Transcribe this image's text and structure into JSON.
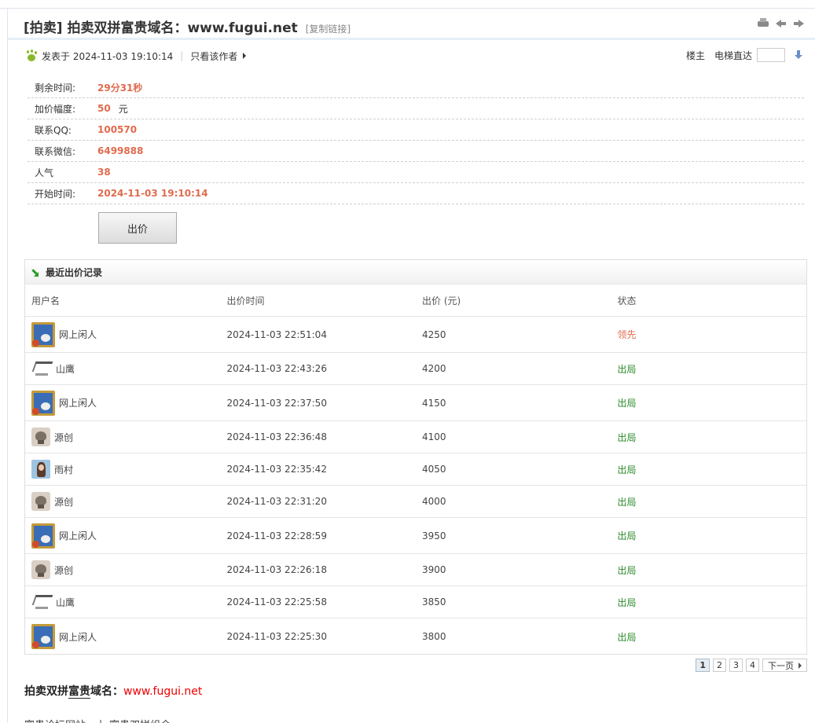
{
  "title": {
    "prefix": "[拍卖]",
    "text": "拍卖双拼富贵域名：www.fugui.net",
    "copy_link": "[复制链接]"
  },
  "meta": {
    "posted": "发表于 2024-11-03 19:10:14",
    "separator": "|",
    "only_author": "只看该作者",
    "floor": "楼主",
    "elevator": "电梯直达"
  },
  "info": [
    {
      "label": "剩余时间:",
      "value": "29分31秒",
      "unit": ""
    },
    {
      "label": "加价幅度:",
      "value": "50",
      "unit": "元"
    },
    {
      "label": "联系QQ:",
      "value": "100570",
      "unit": ""
    },
    {
      "label": "联系微信:",
      "value": "6499888",
      "unit": ""
    },
    {
      "label": "人气",
      "value": "38",
      "unit": ""
    },
    {
      "label": "开始时间:",
      "value": "2024-11-03 19:10:14",
      "unit": ""
    }
  ],
  "bid_button": "出价",
  "records": {
    "title": "最近出价记录",
    "columns": [
      "用户名",
      "出价时间",
      "出价 (元)",
      "状态"
    ],
    "rows": [
      {
        "user": "网上闲人",
        "avatar": "framed-avatar-icon",
        "time": "2024-11-03 22:51:04",
        "price": "4250",
        "status": "领先",
        "lead": true
      },
      {
        "user": "山鹰",
        "avatar": "eagle-avatar-icon",
        "time": "2024-11-03 22:43:26",
        "price": "4200",
        "status": "出局",
        "lead": false
      },
      {
        "user": "网上闲人",
        "avatar": "framed-avatar-icon",
        "time": "2024-11-03 22:37:50",
        "price": "4150",
        "status": "出局",
        "lead": false
      },
      {
        "user": "源创",
        "avatar": "stone-avatar-icon",
        "time": "2024-11-03 22:36:48",
        "price": "4100",
        "status": "出局",
        "lead": false
      },
      {
        "user": "雨村",
        "avatar": "photo-avatar-icon",
        "time": "2024-11-03 22:35:42",
        "price": "4050",
        "status": "出局",
        "lead": false
      },
      {
        "user": "源创",
        "avatar": "stone-avatar-icon",
        "time": "2024-11-03 22:31:20",
        "price": "4000",
        "status": "出局",
        "lead": false
      },
      {
        "user": "网上闲人",
        "avatar": "framed-avatar-icon",
        "time": "2024-11-03 22:28:59",
        "price": "3950",
        "status": "出局",
        "lead": false
      },
      {
        "user": "源创",
        "avatar": "stone-avatar-icon",
        "time": "2024-11-03 22:26:18",
        "price": "3900",
        "status": "出局",
        "lead": false
      },
      {
        "user": "山鹰",
        "avatar": "eagle-avatar-icon",
        "time": "2024-11-03 22:25:58",
        "price": "3850",
        "status": "出局",
        "lead": false
      },
      {
        "user": "网上闲人",
        "avatar": "framed-avatar-icon",
        "time": "2024-11-03 22:25:30",
        "price": "3800",
        "status": "出局",
        "lead": false
      }
    ]
  },
  "pager": {
    "pages": [
      "1",
      "2",
      "3",
      "4"
    ],
    "current": "1",
    "next": "下一页"
  },
  "body": {
    "lead": "拍卖双拼",
    "underlined": "富贵",
    "tail": "域名：",
    "domain": "www.fugui.net",
    "next_line": "富贵论坛网站一上 富贵双拼组合"
  },
  "colors": {
    "accent_value": "#e06b4e",
    "status_out": "#2a8a2a",
    "domain_red": "#ee0000"
  }
}
